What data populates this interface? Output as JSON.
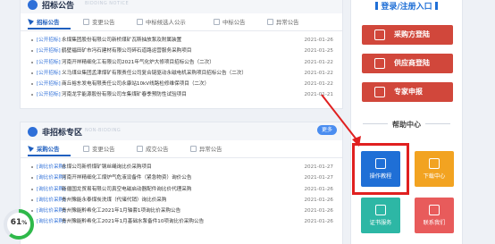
{
  "section_a": {
    "title": "招标公告",
    "subtitle": "BIDDING NOTICE",
    "tabs": [
      "招标公告",
      "变更公告",
      "中标候选人公示",
      "中标公告",
      "异常公告"
    ],
    "rows": [
      {
        "tag": "[公开招标]",
        "text": "永煤集团股份有限公司新桥煤矿瓦斯抽放泵及附属装置",
        "date": "2021-01-26"
      },
      {
        "tag": "[公开招标]",
        "text": "鹤壁福田矿市冯石建材有限公司碎石道路运营服务采购项目",
        "date": "2021-01-25"
      },
      {
        "tag": "[公开招标]",
        "text": "河南开祥精细化工有限公司2021年气化炉大修项目招标公告（二次）",
        "date": "2021-01-22"
      },
      {
        "tag": "[公开招标]",
        "text": "义马煤业集团孟津煤矿有限责任公司复合链驱动永磁电机采购项目招标公告（二次）",
        "date": "2021-01-22"
      },
      {
        "tag": "[公开招标]",
        "text": "商丘裕东发电有限责任公司永康站10kV线路检修维保项目（二次）",
        "date": "2021-01-22"
      },
      {
        "tag": "[公开招标]",
        "text": "河南龙宇能源股份有限公司车集煤矿春季预防性试验项目",
        "date": "2021-01-21"
      }
    ]
  },
  "section_b": {
    "title": "非招标专区",
    "subtitle": "NON-BIDDING",
    "more_label": "更多",
    "tabs": [
      "采购公告",
      "变更公告",
      "成交公告",
      "异常公告"
    ],
    "rows": [
      {
        "tag": "[询比价采购]",
        "text": "永煤公司新桥煤矿钢丝绳询比价采购项目",
        "date": "2021-01-27"
      },
      {
        "tag": "[询比价采购]",
        "text": "河南开祥精细化工煤炉气危液设备件（紧急物资）询价公告",
        "date": "2021-01-27"
      },
      {
        "tag": "[询比价采购]",
        "text": "新疆国龙贸易有限公司真空电磁启动器配件询比价代理采购",
        "date": "2021-01-26"
      },
      {
        "tag": "[询比价采购]",
        "text": "贵州豫能永泰煤炭洗煤（代储代销）询比价采购",
        "date": "2021-01-26"
      },
      {
        "tag": "[询比价采购]",
        "text": "贵州豫能黔希化工2021年1月轴套1项询比价采购公告",
        "date": "2021-01-26"
      },
      {
        "tag": "[询比价采购]",
        "text": "贵州豫能黔希化工2021年1月基础水泵备件10项询比价采购公告",
        "date": "2021-01-26"
      }
    ]
  },
  "login": {
    "title": "登录/注册入口",
    "buttons": [
      "采购方登陆",
      "供应商登陆",
      "专家申报"
    ]
  },
  "help": {
    "title": "帮助中心",
    "tiles": [
      {
        "label": "操作教程",
        "color": "#1f6fd6",
        "icon": "book-icon"
      },
      {
        "label": "下载中心",
        "color": "#f2a321",
        "icon": "download-icon"
      },
      {
        "label": "证书服务",
        "color": "#2db7a5",
        "icon": "certificate-icon"
      },
      {
        "label": "联系我们",
        "color": "#e85b5b",
        "icon": "contact-icon"
      }
    ]
  },
  "gauge": {
    "value": "61",
    "unit": "%",
    "percent": 61
  }
}
